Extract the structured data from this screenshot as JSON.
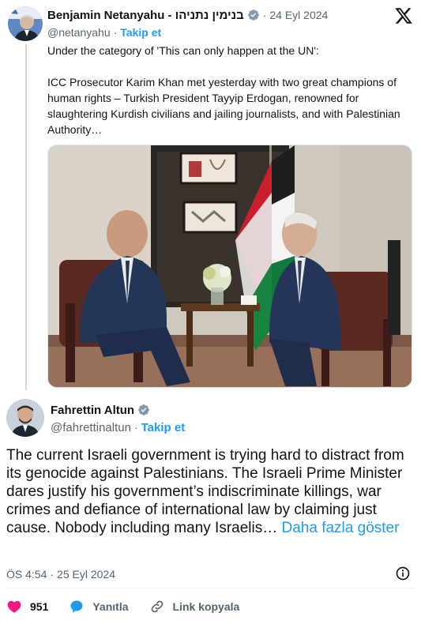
{
  "quoted_tweet": {
    "author_name": "Benjamin Netanyahu - בנימין נתניהו",
    "handle": "@netanyahu",
    "date": "24 Eyl 2024",
    "follow_label": "Takip et",
    "separator": "·",
    "text": "Under the category of 'This can only happen at the UN':\n\nICC Prosecutor Karim Khan met yesterday with two great champions of human rights – Turkish President Tayyip Erdogan, renowned for slaughtering Kurdish civilians and jailing journalists, and with Palestinian Authority…",
    "verified": true
  },
  "main_tweet": {
    "author_name": "Fahrettin Altun",
    "handle": "@fahrettinaltun",
    "follow_label": "Takip et",
    "separator": "·",
    "text": "The current Israeli government is trying hard to distract from its genocide against Palestinians. The Israeli Prime Minister dares justify his government’s indiscriminate killings, war crimes and defiance of international law by claiming just cause. Nobody including many Israelis…",
    "show_more": "Daha fazla göster",
    "time": "ÖS 4:54",
    "date": "25 Eyl 2024",
    "verified": true
  },
  "actions": {
    "like_count": "951",
    "reply_label": "Yanıtla",
    "copy_link_label": "Link kopyala"
  },
  "icons": {
    "brand": "x-logo-icon",
    "verified": "verified-badge-icon",
    "like": "heart-icon",
    "reply": "reply-bubble-icon",
    "link": "link-icon",
    "info": "info-icon"
  },
  "colors": {
    "accent": "#1d9bf0",
    "like": "#f91880",
    "muted": "#536471",
    "text": "#0f1419"
  }
}
